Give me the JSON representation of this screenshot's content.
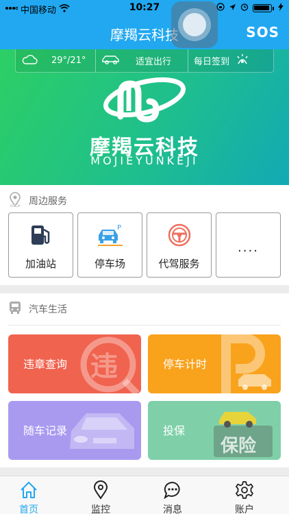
{
  "status_bar": {
    "carrier": "中国移动",
    "time": "10:27"
  },
  "header": {
    "title": "摩羯云科技",
    "sos_label": "SOS"
  },
  "banner": {
    "weather_temp": "29°/21°",
    "travel_status": "适宜出行",
    "checkin_label": "每日签到",
    "brand_cn": "摩羯云科技",
    "brand_en": "MOJIEYUNKEJI"
  },
  "nearby": {
    "title": "周边服务",
    "items": [
      {
        "label": "加油站",
        "icon": "gas-station-icon"
      },
      {
        "label": "停车场",
        "icon": "parking-icon"
      },
      {
        "label": "代驾服务",
        "icon": "steering-wheel-icon"
      },
      {
        "label": "....",
        "icon": "more"
      }
    ]
  },
  "car_life": {
    "title": "汽车生活",
    "cards": [
      {
        "label": "违章查询",
        "color": "#f0634f",
        "icon": "violation-icon"
      },
      {
        "label": "停车计时",
        "color": "#f9a21c",
        "icon": "parking-timer-icon"
      },
      {
        "label": "随车记录",
        "color": "#a99af0",
        "icon": "car-record-icon"
      },
      {
        "label": "投保",
        "color": "#7fd0a8",
        "icon": "insurance-icon"
      }
    ]
  },
  "tabs": [
    {
      "label": "首页",
      "icon": "home-icon",
      "active": true
    },
    {
      "label": "监控",
      "icon": "location-pin-icon",
      "active": false
    },
    {
      "label": "消息",
      "icon": "message-icon",
      "active": false
    },
    {
      "label": "账户",
      "icon": "gear-icon",
      "active": false
    }
  ],
  "colors": {
    "primary": "#21a8f1",
    "banner_green": "#2ccf64",
    "banner_teal": "#13a9b4"
  }
}
